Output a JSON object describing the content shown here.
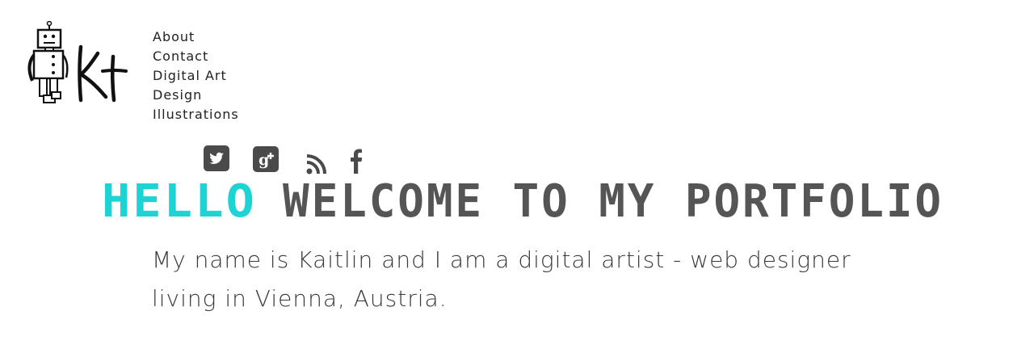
{
  "logo": {
    "initials": "Kt",
    "icon": "robot-icon"
  },
  "nav": {
    "items": [
      {
        "label": "About"
      },
      {
        "label": "Contact"
      },
      {
        "label": "Digital Art"
      },
      {
        "label": "Design"
      },
      {
        "label": "Illustrations"
      }
    ]
  },
  "social": {
    "icons": [
      "twitter-icon",
      "google-plus-icon",
      "rss-icon",
      "facebook-icon"
    ]
  },
  "headline": {
    "accent": "HELLO",
    "rest": "WELCOME TO MY PORTFOLIO",
    "accent_color": "#1ed3d3",
    "rest_color": "#555555"
  },
  "intro": {
    "line1": "My name is Kaitlin and I am a digital artist - web designer",
    "line2": "living in Vienna, Austria."
  }
}
